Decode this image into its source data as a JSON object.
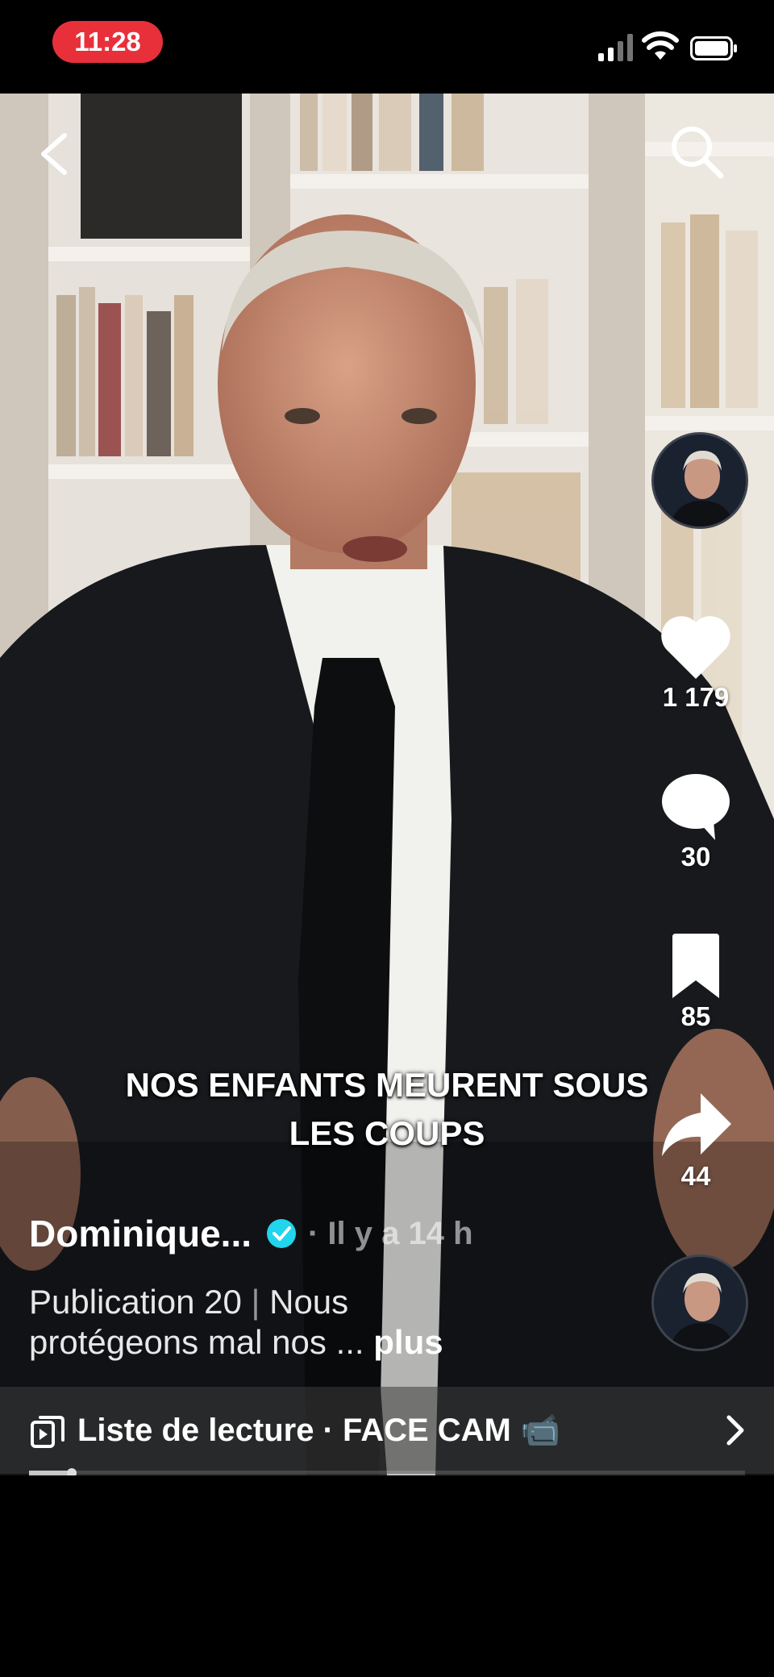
{
  "status_bar": {
    "time": "11:28",
    "icons": [
      "cellular-signal-icon",
      "wifi-icon",
      "battery-icon"
    ]
  },
  "nav": {
    "back_icon": "chevron-left-icon",
    "search_icon": "search-icon"
  },
  "video": {
    "caption_line1": "NOS ENFANTS MEURENT SOUS",
    "caption_line2": "LES COUPS"
  },
  "actions": {
    "likes": "1 179",
    "comments": "30",
    "saves": "85",
    "shares": "44"
  },
  "post": {
    "author": "Dominique...",
    "verified": true,
    "time_ago": "· Il y a 14 h",
    "description_part1": "Publication 20",
    "description_sep": " | ",
    "description_part2": "Nous",
    "description_line2": "protégeons mal nos ... ",
    "more_label": "plus"
  },
  "playlist": {
    "label": "Liste de lecture · FACE CAM 📹"
  },
  "progress": {
    "played_fraction": 0.06
  },
  "colors": {
    "status_pill": "#e8303b",
    "verified": "#20d5ec"
  }
}
